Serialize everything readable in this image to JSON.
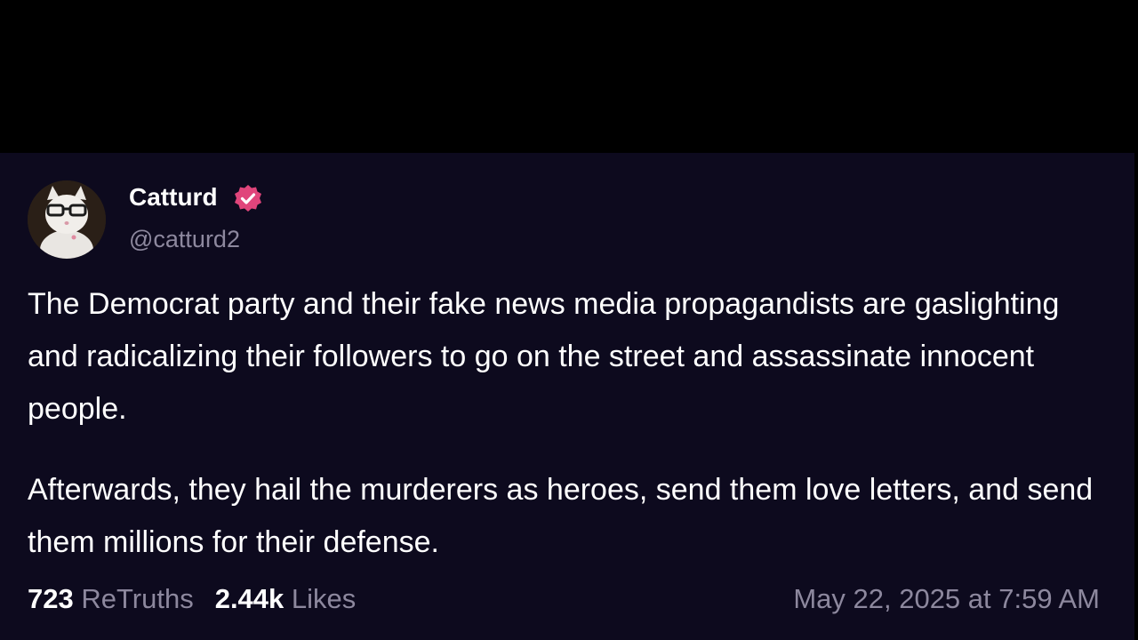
{
  "post": {
    "author": {
      "display_name": "Catturd",
      "handle": "@catturd2",
      "verified": true,
      "avatar_icon": "cat-with-glasses-avatar"
    },
    "paragraphs": [
      "The Democrat party and their fake news media propagandists are gaslighting and radicalizing their followers to go on the street and assassinate innocent people.",
      "Afterwards, they hail the murderers as heroes, send them love letters, and send them millions for their defense."
    ],
    "stats": {
      "retruths_count": "723",
      "retruths_label": "ReTruths",
      "likes_count": "2.44k",
      "likes_label": "Likes"
    },
    "timestamp": "May 22, 2025 at 7:59 AM"
  },
  "colors": {
    "background": "#000000",
    "card": "#0d0a1e",
    "text": "#ffffff",
    "muted": "#8d889e",
    "verified_badge": "#e0457b"
  }
}
